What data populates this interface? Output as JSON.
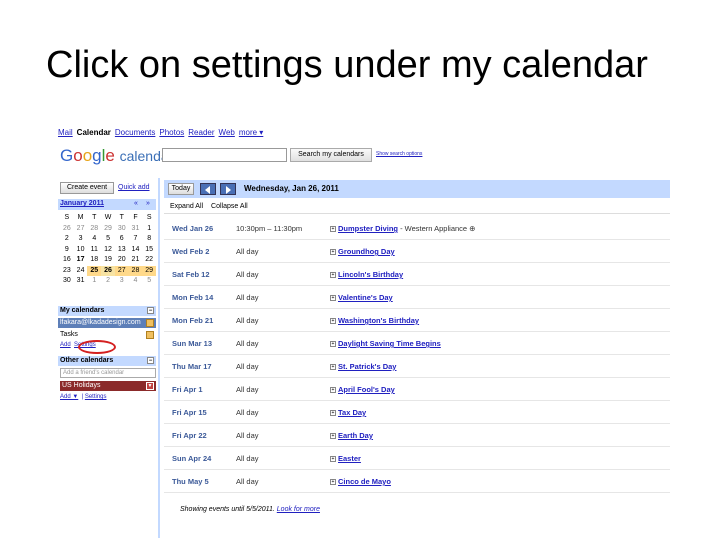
{
  "slide": {
    "title": "Click on settings under my calendar"
  },
  "topnav": {
    "items": [
      "Mail",
      "Calendar",
      "Documents",
      "Photos",
      "Reader",
      "Web",
      "more ▾"
    ]
  },
  "logo": {
    "g": "G",
    "o1": "o",
    "o2": "o",
    "g2": "g",
    "l": "l",
    "e": "e",
    "calendar": "calendar"
  },
  "search": {
    "button": "Search my calendars",
    "options": "Show search options"
  },
  "sidebar": {
    "create_event": "Create event",
    "quick_add": "Quick add",
    "month": "January 2011",
    "nav_prev": "«",
    "nav_next": "»",
    "weekdays": [
      "S",
      "M",
      "T",
      "W",
      "T",
      "F",
      "S"
    ],
    "weeks": [
      [
        "26",
        "27",
        "28",
        "29",
        "30",
        "31",
        "1"
      ],
      [
        "2",
        "3",
        "4",
        "5",
        "6",
        "7",
        "8"
      ],
      [
        "9",
        "10",
        "11",
        "12",
        "13",
        "14",
        "15"
      ],
      [
        "16",
        "17",
        "18",
        "19",
        "20",
        "21",
        "22"
      ],
      [
        "23",
        "24",
        "25",
        "26",
        "27",
        "28",
        "29"
      ],
      [
        "30",
        "31",
        "1",
        "2",
        "3",
        "4",
        "5"
      ]
    ],
    "my_calendars": "My calendars",
    "my_cal_email": "lfakara@lkadadesign.com",
    "tasks": "Tasks",
    "add": "Add",
    "settings": "Settings",
    "other_calendars": "Other calendars",
    "friend_placeholder": "Add a friend's calendar",
    "us_holidays": "US Holidays",
    "other_add": "Add ▼",
    "other_settings": "Settings"
  },
  "main": {
    "today": "Today",
    "date": "Wednesday, Jan 26, 2011",
    "expand_all": "Expand All",
    "collapse_all": "Collapse All",
    "events": [
      {
        "date": "Wed Jan 26",
        "time": "10:30pm – 11:30pm",
        "name": "Dumpster Diving",
        "extra": " - Western Appliance ⊕"
      },
      {
        "date": "Wed Feb 2",
        "time": "All day",
        "name": "Groundhog Day",
        "extra": ""
      },
      {
        "date": "Sat Feb 12",
        "time": "All day",
        "name": "Lincoln's Birthday",
        "extra": ""
      },
      {
        "date": "Mon Feb 14",
        "time": "All day",
        "name": "Valentine's Day",
        "extra": ""
      },
      {
        "date": "Mon Feb 21",
        "time": "All day",
        "name": "Washington's Birthday",
        "extra": ""
      },
      {
        "date": "Sun Mar 13",
        "time": "All day",
        "name": "Daylight Saving Time Begins",
        "extra": ""
      },
      {
        "date": "Thu Mar 17",
        "time": "All day",
        "name": "St. Patrick's Day",
        "extra": ""
      },
      {
        "date": "Fri Apr 1",
        "time": "All day",
        "name": "April Fool's Day",
        "extra": ""
      },
      {
        "date": "Fri Apr 15",
        "time": "All day",
        "name": "Tax Day",
        "extra": ""
      },
      {
        "date": "Fri Apr 22",
        "time": "All day",
        "name": "Earth Day",
        "extra": ""
      },
      {
        "date": "Sun Apr 24",
        "time": "All day",
        "name": "Easter",
        "extra": ""
      },
      {
        "date": "Thu May 5",
        "time": "All day",
        "name": "Cinco de Mayo",
        "extra": ""
      }
    ],
    "footer_text": "Showing events until 5/5/2011. ",
    "footer_link": "Look for more"
  },
  "colors": {
    "accent": "#c3d9ff",
    "link": "#2020c0",
    "holiday": "#8b2a2a",
    "highlight_circle": "#d42020"
  }
}
